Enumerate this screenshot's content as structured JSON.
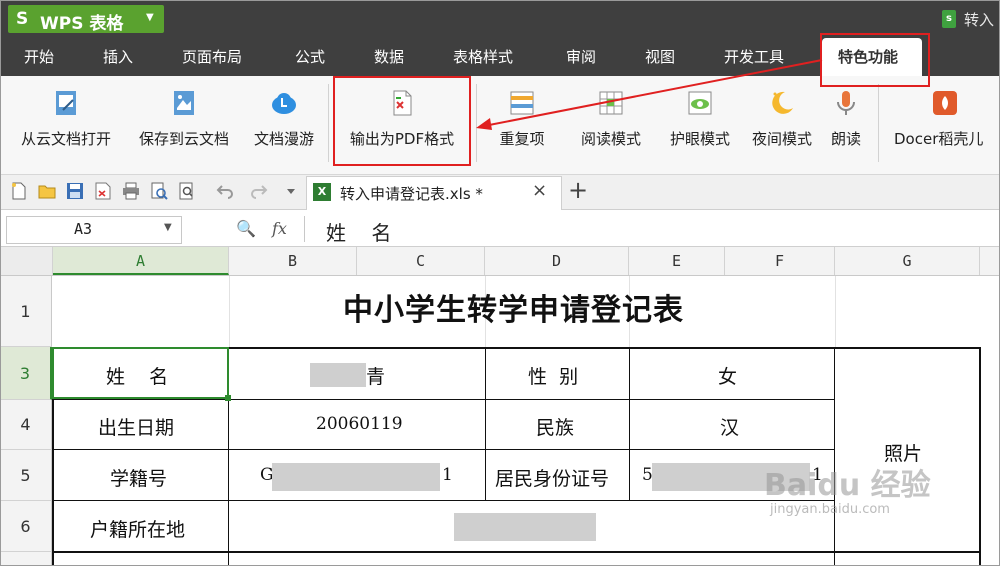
{
  "app": {
    "logo": "S",
    "title": "WPS 表格",
    "doc_title_partial": "转入"
  },
  "menu_tabs": [
    "开始",
    "插入",
    "页面布局",
    "公式",
    "数据",
    "表格样式",
    "审阅",
    "视图",
    "开发工具",
    "特色功能"
  ],
  "ribbon": {
    "open_cloud": "从云文档打开",
    "save_cloud": "保存到云文档",
    "doc_roam": "文档漫游",
    "export_pdf": "输出为PDF格式",
    "duplicates": "重复项",
    "reading_mode": "阅读模式",
    "eye_mode": "护眼模式",
    "night_mode": "夜间模式",
    "read_aloud": "朗读",
    "docer": "Docer稻壳儿"
  },
  "document_tab": {
    "label": "转入申请登记表.xls *",
    "close": "×",
    "new": "+"
  },
  "formula_bar": {
    "cell_ref": "A3",
    "fx": "fx",
    "content": "姓    名"
  },
  "columns": [
    "A",
    "B",
    "C",
    "D",
    "E",
    "F",
    "G"
  ],
  "rows": [
    "1",
    "3",
    "4",
    "5",
    "6"
  ],
  "sheet": {
    "title": "中小学生转学申请登记表",
    "name_label": "姓    名",
    "name_value_visible": "青",
    "gender_label": "性  别",
    "gender_value": "女",
    "dob_label": "出生日期",
    "dob_value": "20060119",
    "ethnicity_label": "民族",
    "ethnicity_value": "汉",
    "student_id_label": "学籍号",
    "student_id_prefix": "G",
    "student_id_suffix": "1",
    "id_card_label": "居民身份证号",
    "id_card_prefix": "5",
    "id_card_suffix": "1",
    "photo_label": "照片",
    "household_label": "户籍所在地"
  },
  "watermark": {
    "line1": "Baidu 经验",
    "line2": "jingyan.baidu.com"
  },
  "colors": {
    "title_bar": "#3f3f3f",
    "accent_green": "#2e8b2e",
    "annotation_red": "#e02020",
    "badge_green": "#5aa22f"
  }
}
